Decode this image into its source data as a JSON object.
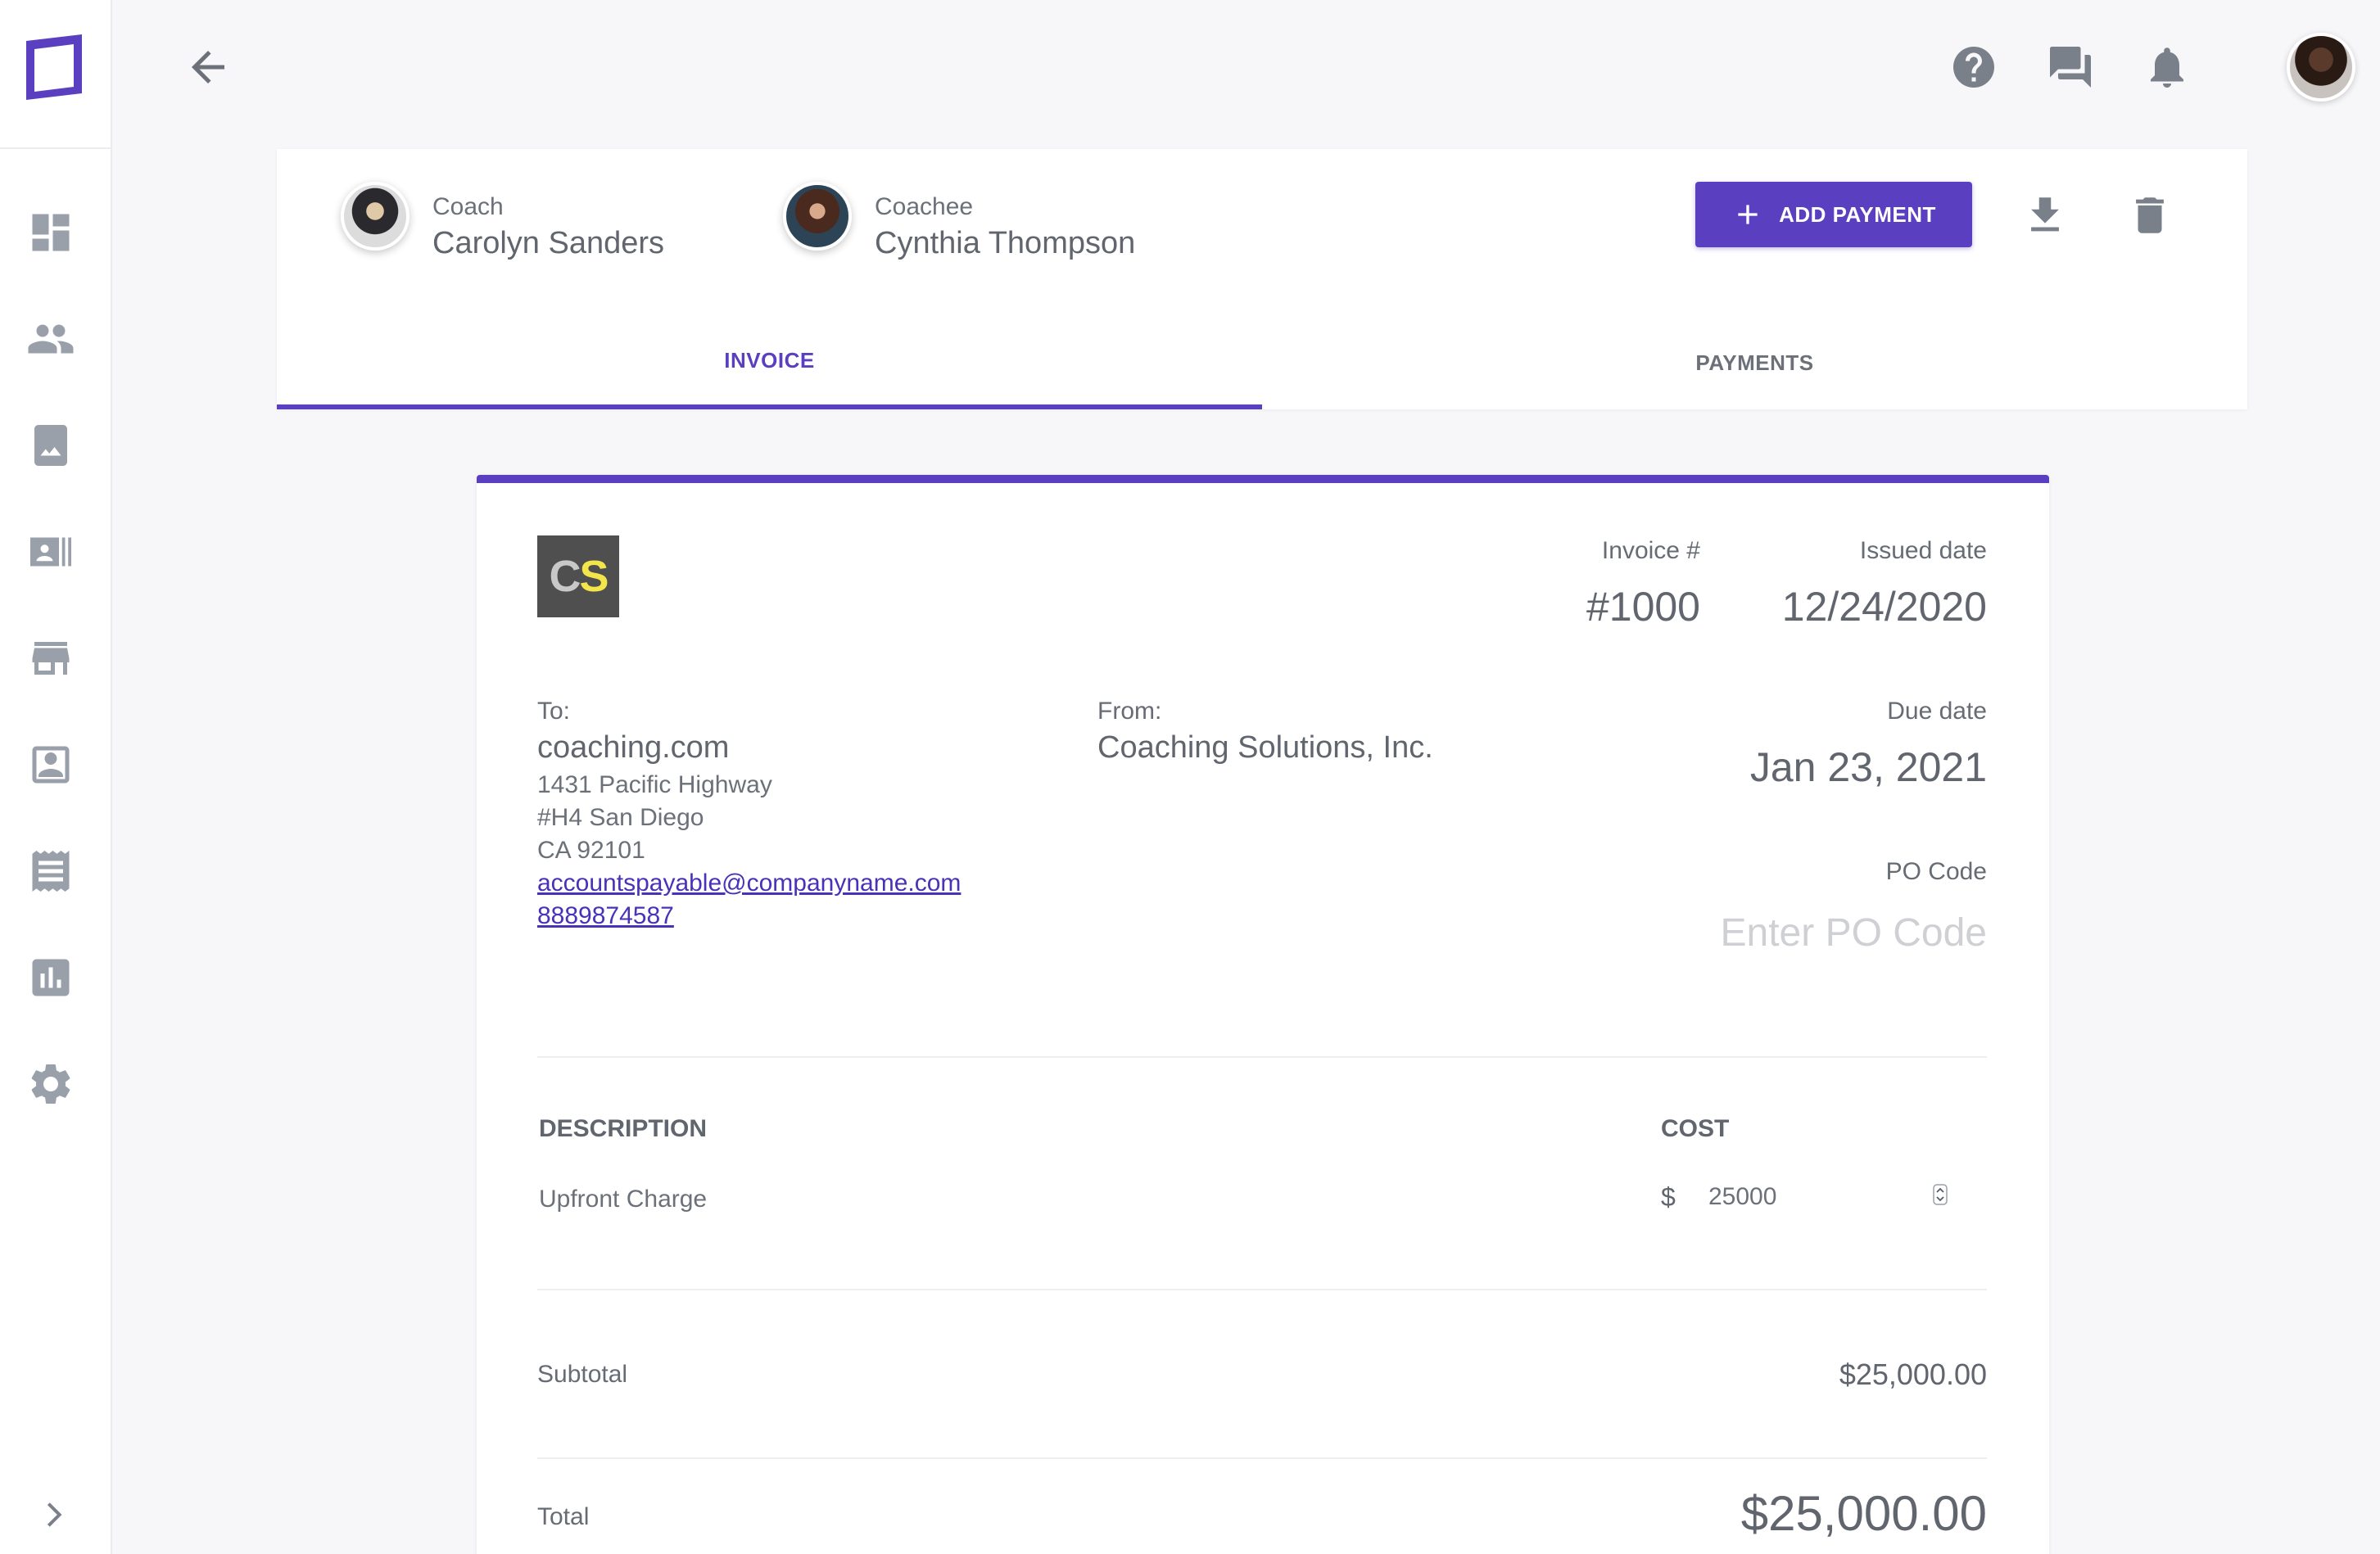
{
  "coach": {
    "role": "Coach",
    "name": "Carolyn Sanders"
  },
  "coachee": {
    "role": "Coachee",
    "name": "Cynthia Thompson"
  },
  "actions": {
    "add_payment": "ADD PAYMENT"
  },
  "tabs": [
    {
      "label": "INVOICE",
      "active": true
    },
    {
      "label": "PAYMENTS",
      "active": false
    }
  ],
  "invoice": {
    "logo_c": "C",
    "logo_s": "S",
    "number_label": "Invoice #",
    "number": "#1000",
    "issued_label": "Issued date",
    "issued": "12/24/2020",
    "to_label": "To:",
    "to_name": "coaching.com",
    "to_address": [
      "1431 Pacific Highway",
      "#H4 San Diego",
      "CA 92101"
    ],
    "to_email": "accountspayable@companyname.com",
    "to_phone": "8889874587",
    "from_label": "From:",
    "from_name": "Coaching Solutions, Inc.",
    "due_label": "Due date",
    "due": "Jan 23, 2021",
    "po_label": "PO Code",
    "po_placeholder": "Enter PO Code",
    "description_header": "DESCRIPTION",
    "cost_header": "COST",
    "item_description": "Upfront Charge",
    "currency": "$",
    "item_cost": "25000",
    "subtotal_label": "Subtotal",
    "subtotal": "$25,000.00",
    "total_label": "Total",
    "total": "$25,000.00"
  },
  "colors": {
    "accent": "#5a3fc0",
    "icon_gray": "#9aa0aa",
    "link": "#4a32b8"
  }
}
